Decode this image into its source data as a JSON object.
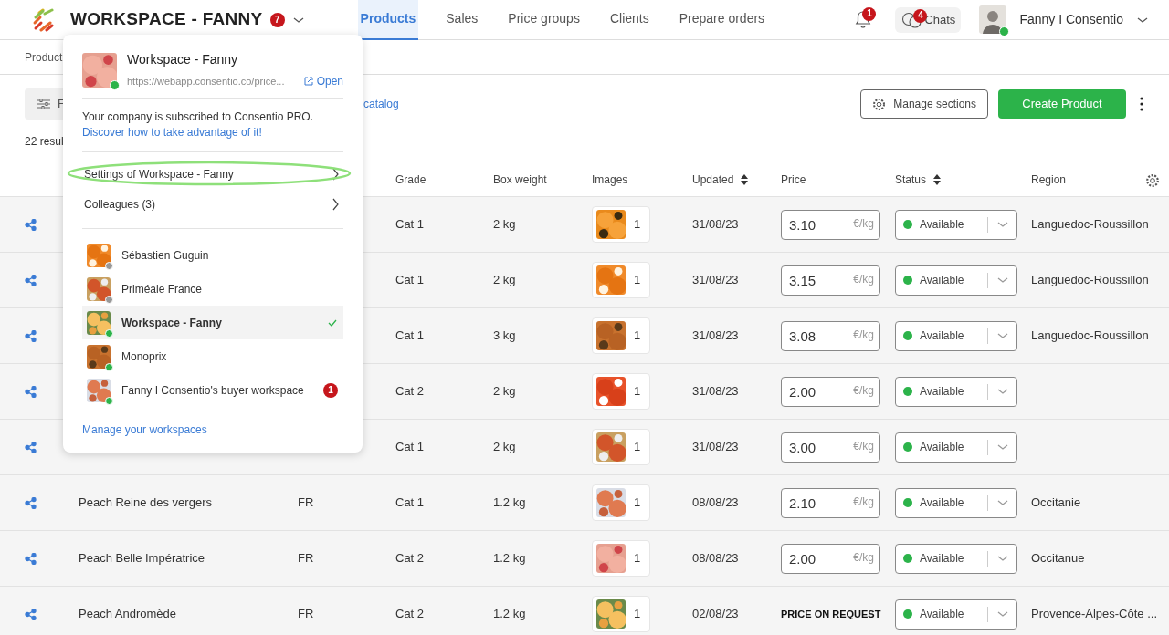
{
  "header": {
    "workspace_name": "WORKSPACE - FANNY",
    "workspace_badge": "7",
    "tabs": [
      {
        "label": "Products",
        "selected": true
      },
      {
        "label": "Sales",
        "selected": false
      },
      {
        "label": "Price groups",
        "selected": false
      },
      {
        "label": "Clients",
        "selected": false
      },
      {
        "label": "Prepare orders",
        "selected": false
      }
    ],
    "notifications_badge": "1",
    "chats": {
      "label": "Chats",
      "badge": "4"
    },
    "user": {
      "name": "Fanny I Consentio",
      "online": true
    }
  },
  "breadcrumb": "Product",
  "toolbar": {
    "filter_label": "F",
    "catalog_link": "catalog",
    "manage_sections": "Manage sections",
    "create_product": "Create Product"
  },
  "results_count": "22 resul",
  "table": {
    "columns": [
      {
        "label": "Grade",
        "sortable": false
      },
      {
        "label": "Box weight",
        "sortable": false
      },
      {
        "label": "Images",
        "sortable": false
      },
      {
        "label": "Updated",
        "sortable": true
      },
      {
        "label": "Price",
        "sortable": false
      },
      {
        "label": "Status",
        "sortable": true
      },
      {
        "label": "Region",
        "sortable": false
      }
    ],
    "rows": [
      {
        "grade": "Cat 1",
        "box_weight": "2 kg",
        "images": {
          "kind": "picture",
          "count": "1"
        },
        "updated": "31/08/23",
        "price": {
          "kind": "input",
          "value": "3.10",
          "unit": "€/kg"
        },
        "status": {
          "label": "Available",
          "available": true
        },
        "region": "Languedoc-Roussillon"
      },
      {
        "grade": "Cat 1",
        "box_weight": "2 kg",
        "images": {
          "kind": "picture",
          "count": "1"
        },
        "updated": "31/08/23",
        "price": {
          "kind": "input",
          "value": "3.15",
          "unit": "€/kg"
        },
        "status": {
          "label": "Available",
          "available": true
        },
        "region": "Languedoc-Roussillon"
      },
      {
        "grade": "Cat 1",
        "box_weight": "3 kg",
        "images": {
          "kind": "picture",
          "count": "1"
        },
        "updated": "31/08/23",
        "price": {
          "kind": "input",
          "value": "3.08",
          "unit": "€/kg"
        },
        "status": {
          "label": "Available",
          "available": true
        },
        "region": "Languedoc-Roussillon"
      },
      {
        "grade": "Cat 2",
        "box_weight": "2 kg",
        "images": {
          "kind": "picture",
          "count": "1"
        },
        "updated": "31/08/23",
        "price": {
          "kind": "input",
          "value": "2.00",
          "unit": "€/kg"
        },
        "status": {
          "label": "Available",
          "available": true
        }
      },
      {
        "grade": "Cat 1",
        "box_weight": "2 kg",
        "images": {
          "kind": "picture",
          "count": "1"
        },
        "updated": "31/08/23",
        "price": {
          "kind": "input",
          "value": "3.00",
          "unit": "€/kg"
        },
        "status": {
          "label": "Available",
          "available": true
        }
      },
      {
        "name": "Peach Reine des vergers",
        "origin": "FR",
        "grade": "Cat 1",
        "box_weight": "1.2 kg",
        "images": {
          "kind": "picture",
          "count": "1"
        },
        "updated": "08/08/23",
        "price": {
          "kind": "input",
          "value": "2.10",
          "unit": "€/kg"
        },
        "status": {
          "label": "Available",
          "available": true
        },
        "region": "Occitanie"
      },
      {
        "name": "Peach Belle Impératrice",
        "origin": "FR",
        "grade": "Cat 2",
        "box_weight": "1.2 kg",
        "images": {
          "kind": "picture",
          "count": "1"
        },
        "updated": "08/08/23",
        "price": {
          "kind": "input",
          "value": "2.00",
          "unit": "€/kg"
        },
        "status": {
          "label": "Available",
          "available": true
        },
        "region": "Occitanue"
      },
      {
        "name": "Peach Andromède",
        "origin": "FR",
        "grade": "Cat 2",
        "box_weight": "1.2 kg",
        "images": {
          "kind": "picture",
          "count": "1"
        },
        "updated": "02/08/23",
        "price": {
          "kind": "text",
          "value": "PRICE ON REQUEST"
        },
        "status": {
          "label": "Available",
          "available": true
        },
        "region": "Provence-Alpes-Côte ..."
      }
    ]
  },
  "workspace_menu": {
    "title": "Workspace - Fanny",
    "url": "https://webapp.consentio.co/price...",
    "open_link": "Open",
    "online": true,
    "subscription_text": "Your company is subscribed to Consentio PRO.",
    "subscription_link": "Discover how to take advantage of it!",
    "entries": [
      {
        "label": "Settings of Workspace - Fanny",
        "highlighted": true
      },
      {
        "label": "Colleagues (3)",
        "highlighted": false
      }
    ],
    "workspaces": [
      {
        "name": "Sébastien Guguin",
        "online": false,
        "selected": false
      },
      {
        "name": "Priméale France",
        "online": false,
        "selected": false
      },
      {
        "name": "Workspace - Fanny",
        "online": true,
        "selected": true
      },
      {
        "name": "Monoprix",
        "online": true,
        "selected": false
      },
      {
        "name": "Fanny I Consentio's buyer workspace",
        "online": true,
        "selected": false,
        "badge": "1"
      }
    ],
    "manage_link": "Manage your workspaces"
  }
}
